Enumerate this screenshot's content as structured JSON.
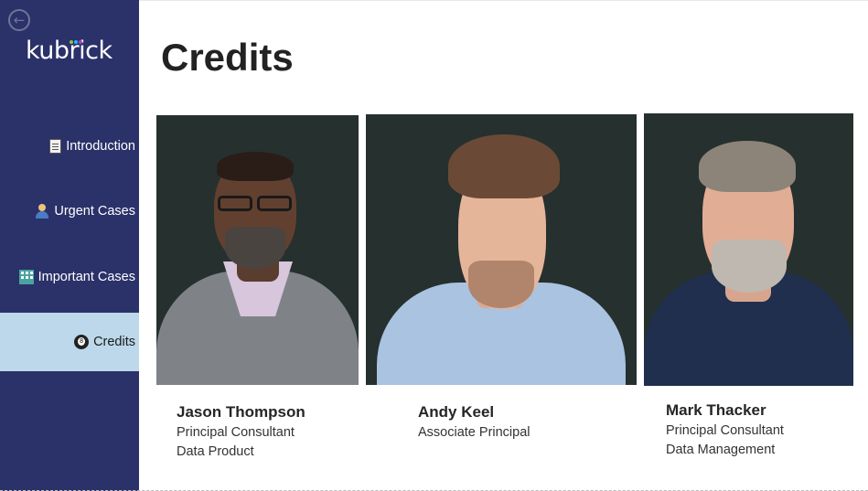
{
  "sidebar": {
    "logo": "kubrick",
    "logo_dot_colors": [
      "#8bc34a",
      "#29b6f6",
      "#ab47bc",
      "#ff7043"
    ],
    "back_icon": "arrow-left-circle-icon",
    "items": [
      {
        "label": "Introduction",
        "icon": "document-icon",
        "active": false
      },
      {
        "label": "Urgent Cases",
        "icon": "person-icon",
        "active": false
      },
      {
        "label": "Important Cases",
        "icon": "building-icon",
        "active": false
      },
      {
        "label": "Credits",
        "icon": "eight-ball-icon",
        "active": true
      }
    ],
    "background": "#2b3169",
    "active_background": "#bcd8ea"
  },
  "main": {
    "title": "Credits",
    "people": [
      {
        "name": "Jason Thompson",
        "role_line1": "Principal Consultant",
        "role_line2": "Data Product"
      },
      {
        "name": "Andy Keel",
        "role_line1": "Associate Principal",
        "role_line2": ""
      },
      {
        "name": "Mark Thacker",
        "role_line1": "Principal Consultant",
        "role_line2": "Data Management"
      }
    ]
  }
}
